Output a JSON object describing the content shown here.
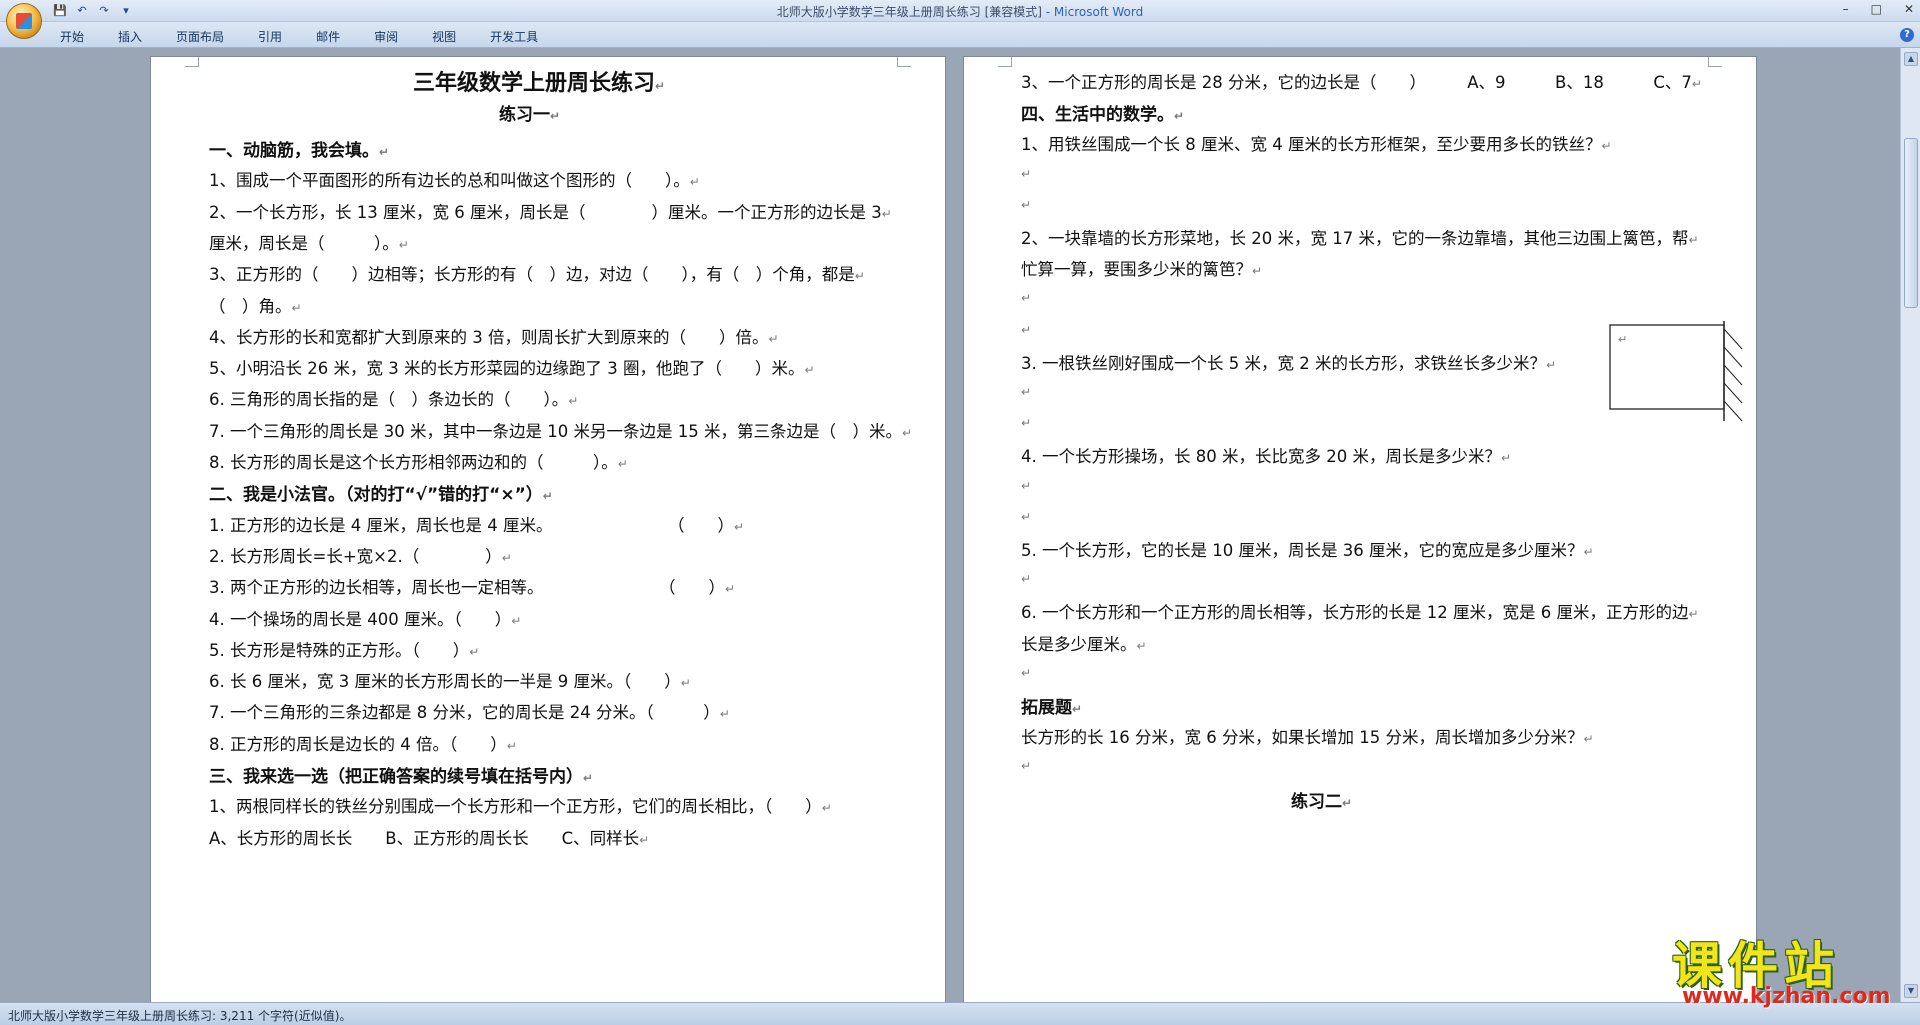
{
  "window": {
    "title": "北师大版小学数学三年级上册周长练习 [兼容模式]",
    "app_name": " - Microsoft Word",
    "controls": [
      "–",
      "□",
      "✕"
    ],
    "help": "?"
  },
  "quick_access": [
    "💾",
    "↶",
    "↷",
    "▾"
  ],
  "ribbon": {
    "tabs": [
      "开始",
      "插入",
      "页面布局",
      "引用",
      "邮件",
      "审阅",
      "视图",
      "开发工具"
    ]
  },
  "left_page": {
    "title": "三年级数学上册周长练习",
    "subtitle": "练习一",
    "lines": [
      {
        "text": "一、动脑筋，我会填。",
        "bold": true
      },
      {
        "text": "1、围成一个平面图形的所有边长的总和叫做这个图形的（　　）。"
      },
      {
        "text": "2、一个长方形，长 13 厘米，宽 6 厘米，周长是（　　　　）厘米。一个正方形的边长是 3"
      },
      {
        "text": "厘米，周长是（　　　）。"
      },
      {
        "text": "3、正方形的（　　）边相等；长方形的有（　）边，对边（　　），有（　）个角，都是"
      },
      {
        "text": "（　）角。"
      },
      {
        "text": "4、长方形的长和宽都扩大到原来的 3 倍，则周长扩大到原来的（　　）倍。"
      },
      {
        "text": "5、小明沿长 26 米，宽 3 米的长方形菜园的边缘跑了 3 圈，他跑了（　　）米。"
      },
      {
        "text": "6. 三角形的周长指的是（　）条边长的（　　）。"
      },
      {
        "text": "7. 一个三角形的周长是 30 米，其中一条边是 10 米另一条边是 15 米，第三条边是（　）米。"
      },
      {
        "text": "8. 长方形的周长是这个长方形相邻两边和的（　　　）。"
      },
      {
        "text": "二、我是小法官。（对的打“√”错的打“×”）",
        "bold": true
      },
      {
        "text": "1. 正方形的边长是 4 厘米，周长也是 4 厘米。　　　　　　　　（　　）"
      },
      {
        "text": "2. 长方形周长=长+宽×2.（　　　　）"
      },
      {
        "text": "3. 两个正方形的边长相等，周长也一定相等。　　　　　　　　（　　）"
      },
      {
        "text": "4. 一个操场的周长是 400 厘米。（　　）"
      },
      {
        "text": "5. 长方形是特殊的正方形。（　　）"
      },
      {
        "text": "6. 长 6 厘米，宽 3 厘米的长方形周长的一半是 9 厘米。（　　）"
      },
      {
        "text": "7. 一个三角形的三条边都是 8 分米，它的周长是 24 分米。（　　　）"
      },
      {
        "text": "8. 正方形的周长是边长的 4 倍。（　　）"
      },
      {
        "text": "三、我来选一选（把正确答案的续号填在括号内）",
        "bold": true
      },
      {
        "text": "1、两根同样长的铁丝分别围成一个长方形和一个正方形，它们的周长相比，（　　）"
      },
      {
        "text": "A、长方形的周长长　　B、正方形的周长长　　C、同样长"
      }
    ]
  },
  "right_page": {
    "lines": [
      {
        "text": "3、一个正方形的周长是 28 分米，它的边长是（　　）　　　A、9　　　B、18　　　C、7"
      },
      {
        "text": "四、生活中的数学。",
        "bold": true
      },
      {
        "text": "1、用铁丝围成一个长 8 厘米、宽 4 厘米的长方形框架，至少要用多长的铁丝？"
      },
      {
        "text": ""
      },
      {
        "text": ""
      },
      {
        "text": "2、一块靠墙的长方形菜地，长 20 米，宽 17 米，它的一条边靠墙，其他三边围上篱笆，帮"
      },
      {
        "text": "忙算一算，要围多少米的篱笆？"
      },
      {
        "text": ""
      },
      {
        "text": ""
      },
      {
        "text": "3. 一根铁丝刚好围成一个长 5 米，宽 2 米的长方形，求铁丝长多少米？"
      },
      {
        "text": ""
      },
      {
        "text": ""
      },
      {
        "text": "4. 一个长方形操场，长 80 米，长比宽多 20 米，周长是多少米？"
      },
      {
        "text": ""
      },
      {
        "text": ""
      },
      {
        "text": "5. 一个长方形，它的长是 10 厘米，周长是 36 厘米，它的宽应是多少厘米？"
      },
      {
        "text": ""
      },
      {
        "text": "6. 一个长方形和一个正方形的周长相等，长方形的长是 12 厘米，宽是 6 厘米，正方形的边"
      },
      {
        "text": "长是多少厘米。"
      },
      {
        "text": ""
      },
      {
        "text": "拓展题",
        "bold": true
      },
      {
        "text": "长方形的长 16 分米，宽 6 分米，如果长增加 15 分米，周长增加多少分米？"
      },
      {
        "text": ""
      },
      {
        "text": "练习二",
        "bold": true,
        "center": true
      }
    ]
  },
  "pilcrow": "↵",
  "status": "北师大版小学数学三年级上册周长练习: 3,211 个字符(近似值)。",
  "watermark": {
    "cn": "课件站",
    "url": "www.kjzhan.com"
  }
}
